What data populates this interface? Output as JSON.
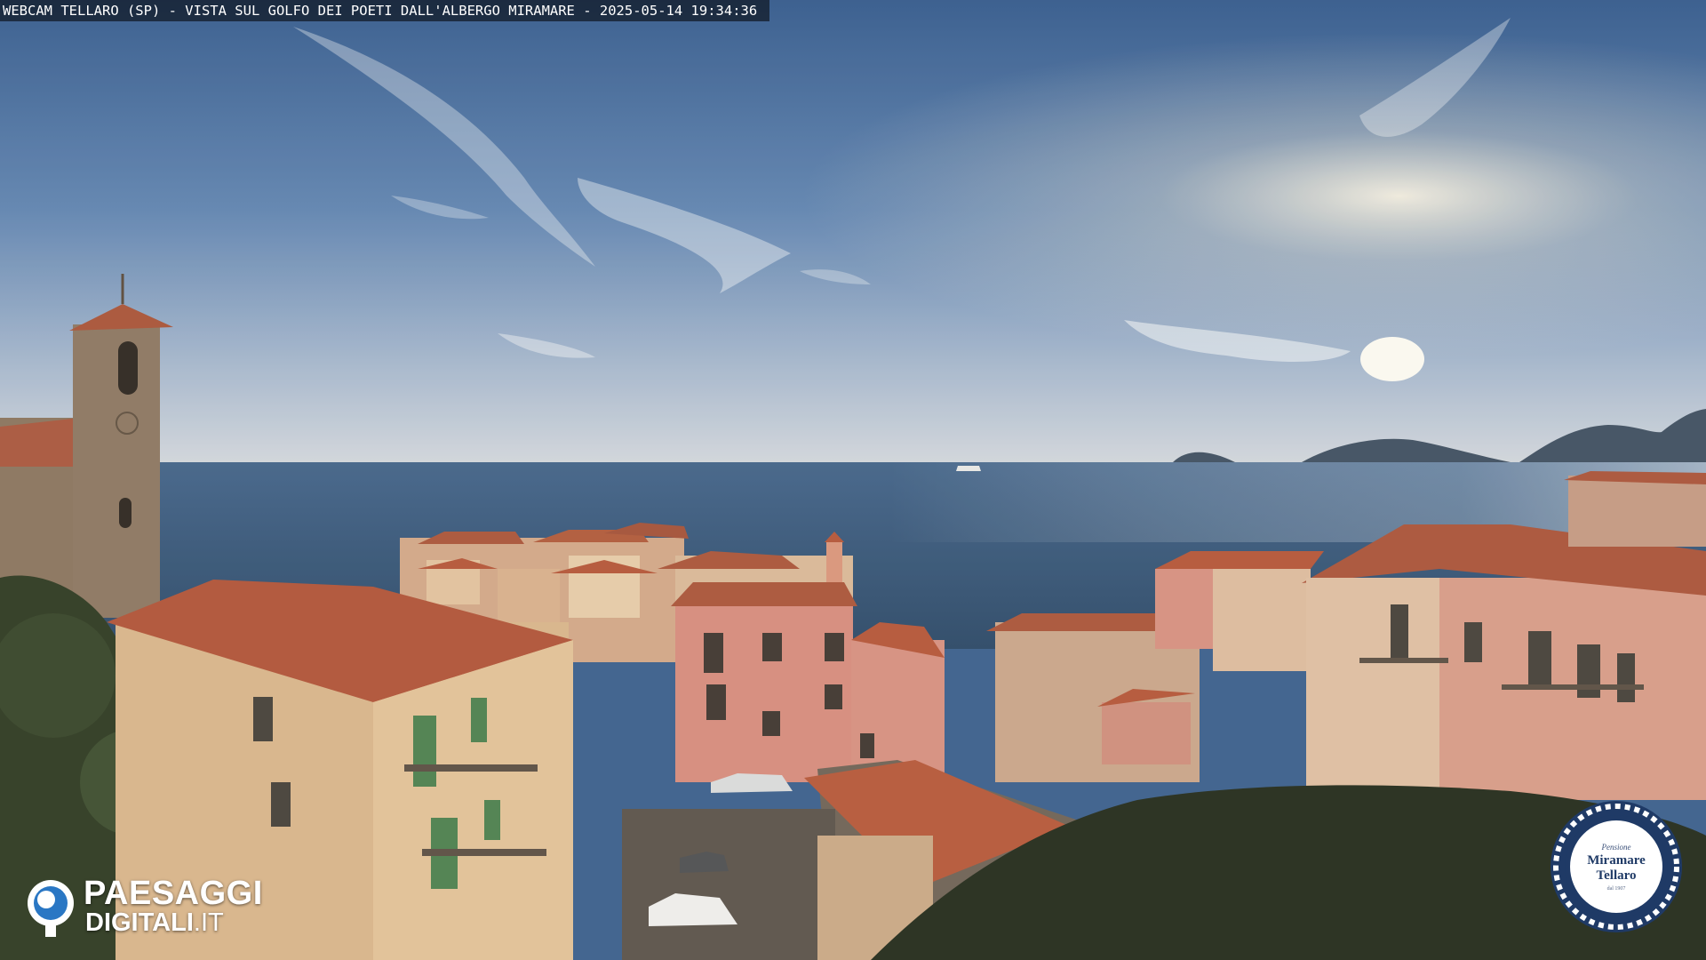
{
  "caption": "WEBCAM TELLARO (SP) - VISTA SUL GOLFO DEI POETI DALL'ALBERGO MIRAMARE - 2025-05-14 19:34:36",
  "logo": {
    "word1": "PAESAGGI",
    "word2": "DIGITALI",
    "word2_suffix": ".IT"
  },
  "badge": {
    "line_small": "Pensione",
    "line1": "Miramare",
    "line2": "Tellaro",
    "line_tiny": "dal 1907"
  },
  "colors": {
    "sky_top": "#3a5f93",
    "sky_horizon": "#c9d3de",
    "sea": "#35557a",
    "roof": "#b4553a",
    "wall_pink": "#d68b7e",
    "wall_cream": "#dfc096"
  }
}
